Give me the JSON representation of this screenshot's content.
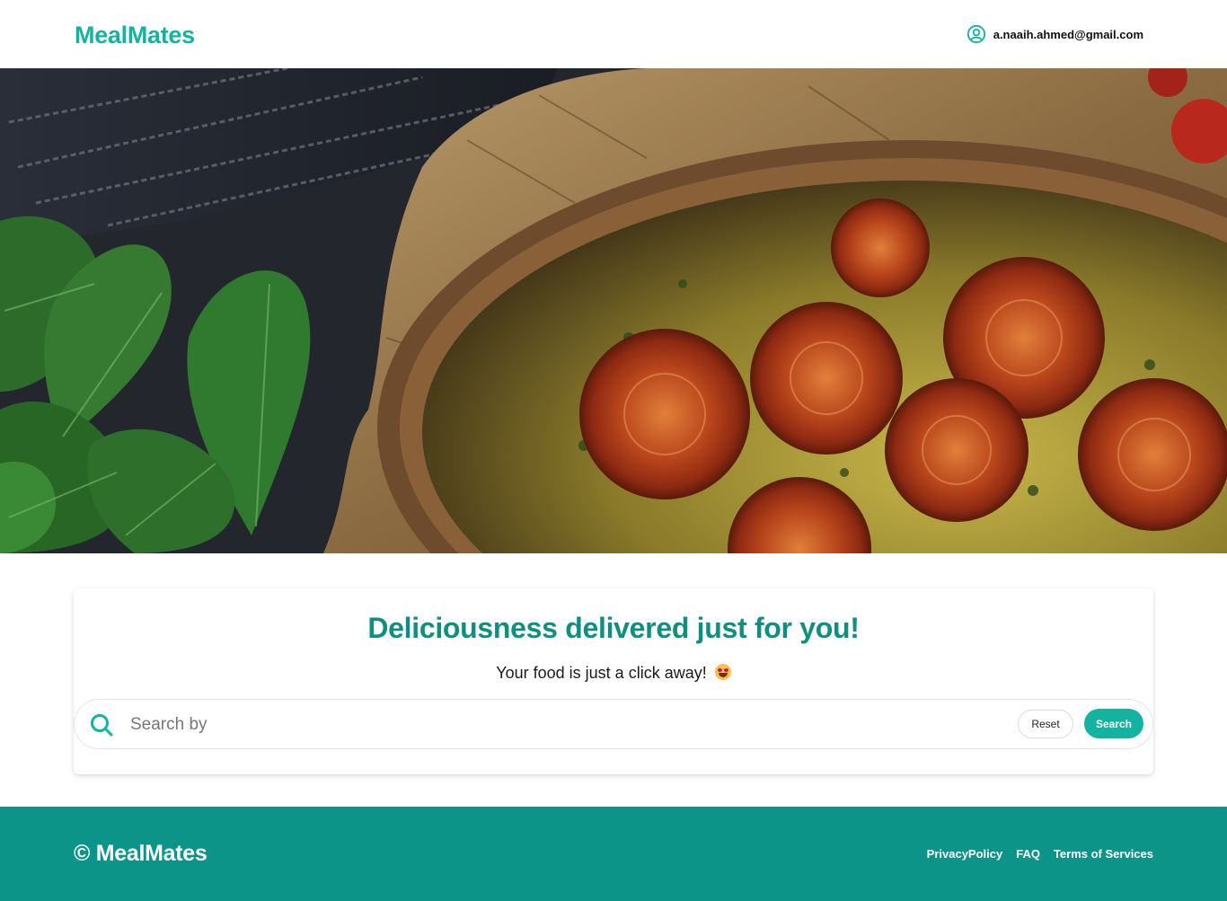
{
  "header": {
    "brand": "MealMates",
    "user_email": "a.naaih.ahmed@gmail.com",
    "user_icon": "user-circle-icon"
  },
  "hero": {
    "image": "quiche-with-roasted-tomatoes-and-spinach-photo"
  },
  "main": {
    "headline": "Deliciousness delivered just for you!",
    "subline": "Your food is just a click away!",
    "emoji": "smiling-face-emoji",
    "search": {
      "placeholder": "Search by",
      "value": "",
      "icon": "search-icon",
      "reset_label": "Reset",
      "search_label": "Search"
    }
  },
  "footer": {
    "copyright": "© MealMates",
    "links": [
      "PrivacyPolicy",
      "FAQ",
      "Terms of Services"
    ]
  },
  "colors": {
    "brand": "#14b3a0",
    "headline": "#0f8f80",
    "footer_bg": "#0d9488"
  }
}
